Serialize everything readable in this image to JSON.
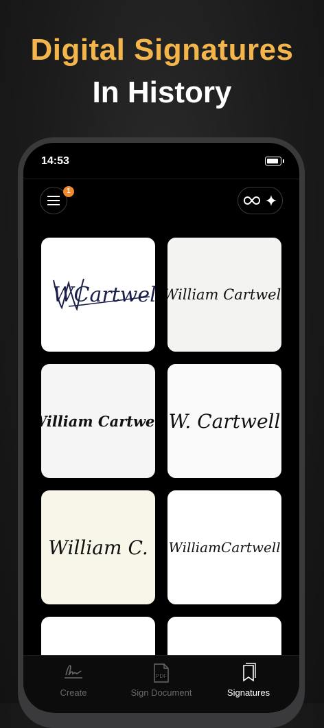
{
  "headline": {
    "line1": "Digital Signatures",
    "line2": "In History"
  },
  "status_bar": {
    "time": "14:53"
  },
  "header": {
    "menu_icon": "hamburger-menu-icon",
    "notification_count": "1",
    "pro_icons": [
      "infinity-icon",
      "sparkle-icon"
    ]
  },
  "signatures": [
    {
      "text": "WCartwell",
      "background": "#FFFFFF",
      "ink": "#1a1f4a"
    },
    {
      "text": "William Cartwell",
      "background": "#F3F3F1",
      "ink": "#111111"
    },
    {
      "text": "William Cartwell",
      "background": "#F5F5F5",
      "ink": "#111111"
    },
    {
      "text": "W. Cartwell",
      "background": "#FAFAFA",
      "ink": "#111111"
    },
    {
      "text": "William C.",
      "background": "#F7F6E8",
      "ink": "#111111"
    },
    {
      "text": "WilliamCartwell",
      "background": "#FFFFFF",
      "ink": "#111111"
    },
    {
      "text": "",
      "background": "#FFFFFF",
      "ink": "#111111"
    },
    {
      "text": "",
      "background": "#FFFFFF",
      "ink": "#111111"
    }
  ],
  "tabs": [
    {
      "label": "Create",
      "icon": "signature-pen-icon",
      "active": false
    },
    {
      "label": "Sign Document",
      "icon": "pdf-document-icon",
      "active": false
    },
    {
      "label": "Signatures",
      "icon": "bookmarks-icon",
      "active": true
    }
  ],
  "colors": {
    "accent": "#F4B64A",
    "badge": "#F08A2C",
    "tab_inactive": "#6a6a6e",
    "tab_active": "#FFFFFF"
  }
}
